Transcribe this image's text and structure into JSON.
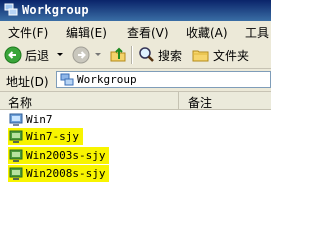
{
  "window": {
    "title": "Workgroup"
  },
  "menu": [
    "文件(F)",
    "编辑(E)",
    "查看(V)",
    "收藏(A)",
    "工具"
  ],
  "toolbar": {
    "back_label": "后退",
    "search_label": "搜索",
    "folders_label": "文件夹"
  },
  "address": {
    "label": "地址(D)",
    "value": "Workgroup"
  },
  "columns": {
    "name": "名称",
    "comment": "备注"
  },
  "items": [
    {
      "label": "Win7",
      "highlighted": false
    },
    {
      "label": "Win7-sjy",
      "highlighted": true
    },
    {
      "label": "Win2003s-sjy",
      "highlighted": true
    },
    {
      "label": "Win2008s-sjy",
      "highlighted": true
    }
  ],
  "colors": {
    "highlight": "#f8f400",
    "title_bar": "#0a246a",
    "chrome": "#ece9d8"
  }
}
